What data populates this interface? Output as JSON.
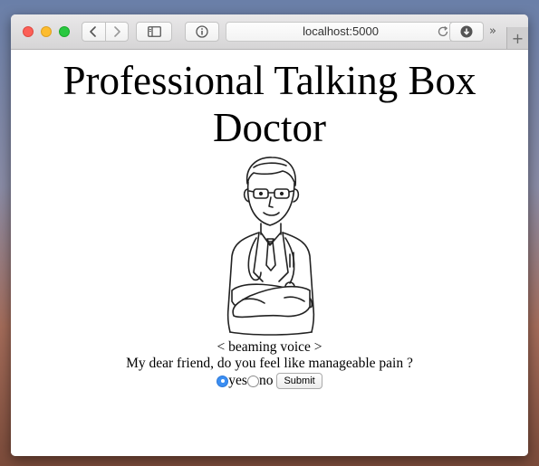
{
  "browser": {
    "url": "localhost:5000",
    "more_label": "»",
    "new_tab_label": "+"
  },
  "page": {
    "title_line1": "Professional Talking Box",
    "title_line2": "Doctor",
    "voice": "< beaming voice >",
    "question": "My dear friend, do you feel like manageable pain ?",
    "options": [
      {
        "label": "yes",
        "checked": true
      },
      {
        "label": "no",
        "checked": false
      }
    ],
    "submit_label": "Submit"
  },
  "colors": {
    "radio_selected": "#3b8ef2",
    "close": "#fc5f57",
    "minimize": "#fdbc2e",
    "zoom": "#29c840"
  },
  "icons": [
    "chevron-left-icon",
    "chevron-right-icon",
    "sidebar-icon",
    "info-icon",
    "reload-icon",
    "download-icon",
    "doctor-illustration"
  ]
}
